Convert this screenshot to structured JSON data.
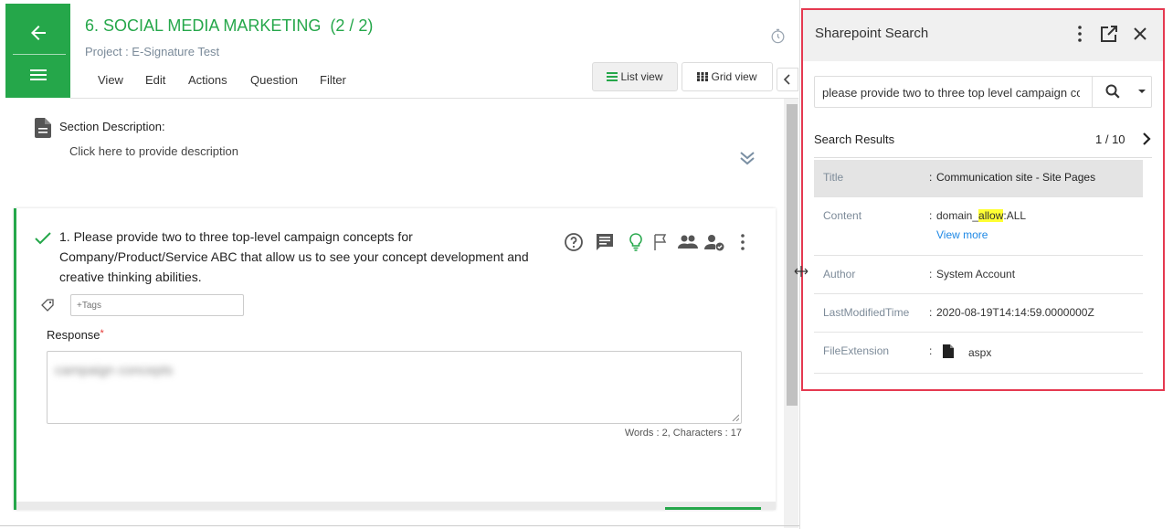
{
  "header": {
    "title": "6. SOCIAL MEDIA MARKETING  (2 / 2)",
    "project": "Project : E-Signature Test",
    "menu": [
      "View",
      "Edit",
      "Actions",
      "Question",
      "Filter"
    ],
    "list_view_label": "List view",
    "grid_view_label": "Grid view",
    "accent_color": "#25a74a"
  },
  "section": {
    "label": "Section Description:",
    "placeholder": "Click here to provide description"
  },
  "question": {
    "text": "1. Please provide two to three top-level campaign concepts for Company/Product/Service ABC that allow us to see your concept development and creative thinking abilities.",
    "tags_placeholder": "+Tags",
    "response_label": "Response",
    "required_mark": "*",
    "response_value": "campaign concepts",
    "word_count": "Words : 2, Characters : 17",
    "icons": [
      "help-icon",
      "comment-icon",
      "lightbulb-icon",
      "flag-icon",
      "people-icon",
      "user-check-icon",
      "more-vertical-icon"
    ]
  },
  "sharepoint": {
    "title": "Sharepoint Search",
    "search_value": "please provide two to three top level campaign concepts",
    "results_label": "Search Results",
    "page_count": "1 / 10",
    "highlight_color": "#ffff33",
    "rows": {
      "title": {
        "key": "Title",
        "value": "Communication site - Site Pages"
      },
      "content": {
        "key": "Content",
        "value_prefix": "domain_",
        "value_highlight": "allow",
        "value_suffix": ":ALL",
        "view_more": "View more"
      },
      "author": {
        "key": "Author",
        "value": "System Account"
      },
      "modified": {
        "key": "LastModifiedTime",
        "value": "2020-08-19T14:14:59.0000000Z"
      },
      "extension": {
        "key": "FileExtension",
        "value": "aspx"
      }
    },
    "colon": ":"
  }
}
